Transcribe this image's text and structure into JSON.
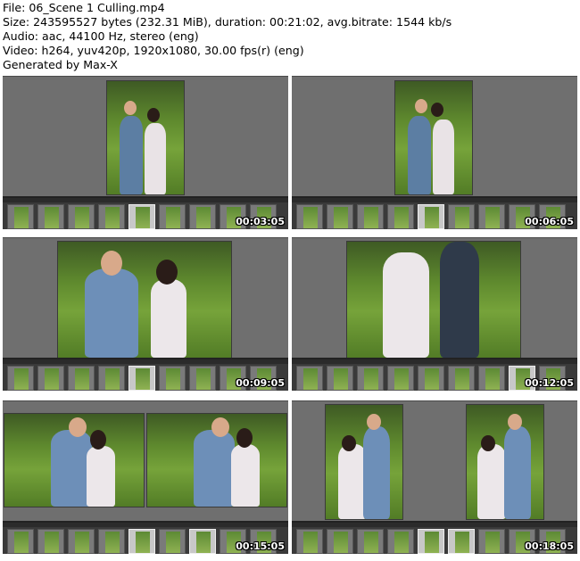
{
  "info": {
    "file": "File: 06_Scene 1 Culling.mp4",
    "size": "Size: 243595527 bytes (232.31 MiB), duration: 00:21:02, avg.bitrate: 1544 kb/s",
    "audio": "Audio: aac, 44100 Hz, stereo (eng)",
    "video": "Video: h264, yuv420p, 1920x1080, 30.00 fps(r) (eng)",
    "generator": "Generated by Max-X"
  },
  "thumbnails": [
    {
      "timestamp": "00:03:05"
    },
    {
      "timestamp": "00:06:05"
    },
    {
      "timestamp": "00:09:05"
    },
    {
      "timestamp": "00:12:05"
    },
    {
      "timestamp": "00:15:05"
    },
    {
      "timestamp": "00:18:05"
    }
  ]
}
